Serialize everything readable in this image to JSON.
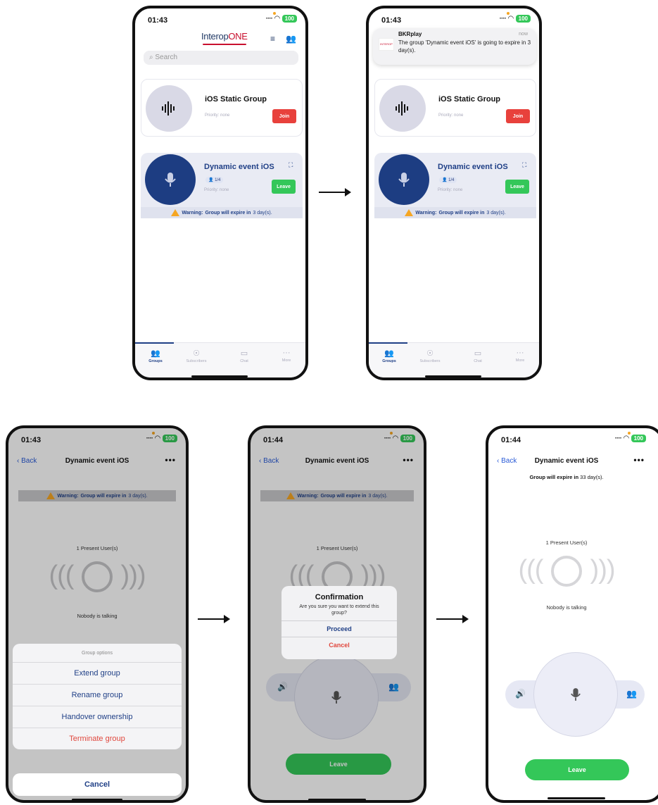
{
  "status": {
    "time_1": "01:43",
    "time_2": "01:44",
    "battery": "100"
  },
  "app": {
    "logo_main": "Interop",
    "logo_accent": "ONE"
  },
  "search": {
    "placeholder": "Search"
  },
  "static_group": {
    "name": "iOS Static Group",
    "priority": "Priority: none",
    "join": "Join"
  },
  "dynamic_group": {
    "name": "Dynamic event iOS",
    "members": "1/4",
    "priority": "Priority: none",
    "leave": "Leave"
  },
  "warning": {
    "label": "Warning:",
    "text": "Group will expire in",
    "days": "3 day(s)."
  },
  "tabs": [
    "Groups",
    "Subscribers",
    "Chat",
    "More"
  ],
  "notification": {
    "app": "BKRplay",
    "time": "now",
    "body": "The group 'Dynamic event iOS' is going to expire in 3 day(s).",
    "icon_text": "INTEROP"
  },
  "detail": {
    "back": "Back",
    "title": "Dynamic event iOS",
    "more": "•••",
    "present": "1 Present User(s)",
    "nobody": "Nobody is talking",
    "leave": "Leave"
  },
  "sheet": {
    "header": "Group options",
    "items": [
      "Extend group",
      "Rename group",
      "Handover ownership",
      "Terminate group"
    ],
    "cancel": "Cancel"
  },
  "dialog": {
    "title": "Confirmation",
    "message": "Are you sure you want to extend this group?",
    "proceed": "Proceed",
    "cancel": "Cancel"
  },
  "extended": {
    "text": "Group will expire in",
    "days": "33 day(s)."
  },
  "colors": {
    "navy": "#1f3f86",
    "join_red": "#e8413c",
    "leave_green": "#34c759",
    "warning_orange": "#f5a623"
  }
}
